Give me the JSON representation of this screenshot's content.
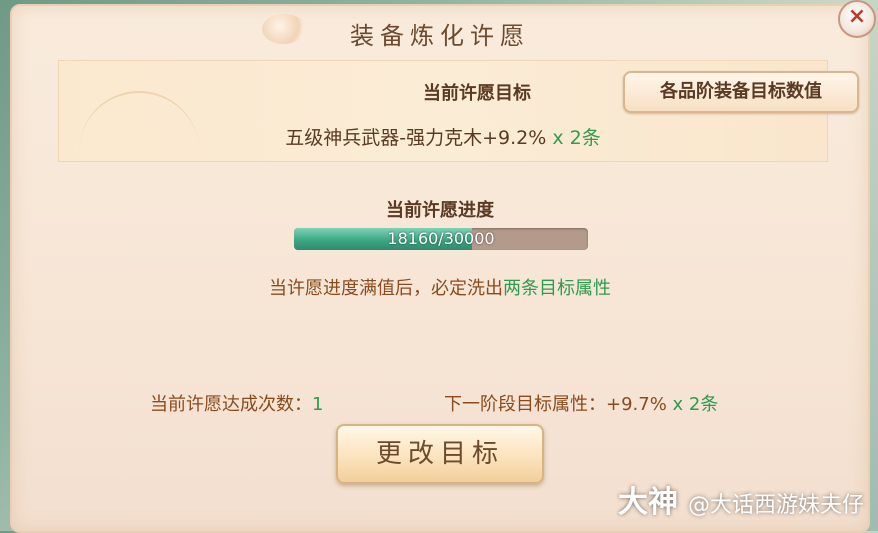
{
  "dialog": {
    "title": "装备炼化许愿",
    "close_icon_glyph": "×"
  },
  "target": {
    "heading": "当前许愿目标",
    "grade_button_label": "各品阶装备目标数值",
    "item_text": "五级神兵武器-强力克木+9.2%",
    "quantity_text": " x 2条"
  },
  "progress": {
    "heading": "当前许愿进度",
    "text": "18160/30000",
    "fraction": 0.6053,
    "hint_prefix": "当许愿进度满值后，必定洗出",
    "hint_highlight": "两条目标属性"
  },
  "stats": {
    "achieved_label": "当前许愿达成次数：",
    "achieved_value": "1",
    "next_label": "下一阶段目标属性：",
    "next_value": "+9.7%",
    "next_quantity": " x 2条"
  },
  "actions": {
    "change_target_label": "更改目标"
  },
  "watermark": {
    "brand": "大神",
    "handle": "@大话西游妹夫仔"
  },
  "colors": {
    "highlight_green": "#2e9b4e",
    "progress_fill": "#3fa785"
  }
}
